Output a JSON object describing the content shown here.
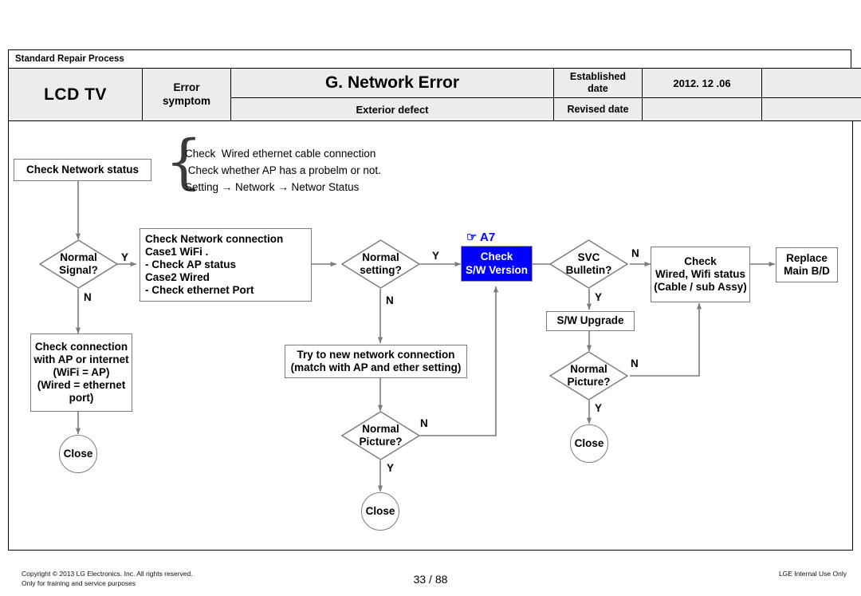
{
  "header": {
    "process_title": "Standard Repair Process",
    "model": "LCD  TV",
    "error_symptom_label": "Error\nsymptom",
    "main_title": "G. Network Error",
    "main_subtitle": "Exterior defect",
    "established_date_label": "Established\ndate",
    "established_date_value": "2012. 12 .06",
    "revised_date_label": "Revised date",
    "revised_date_value": "",
    "blank_cell_top": "",
    "blank_cell_bottom": ""
  },
  "flow": {
    "start_box": "Check  Network status",
    "annotation": "Check  Wired ethernet cable connection\n Check whether AP has a probelm or not.\nSetting → Network → Networ Status",
    "brace_glyph": "{",
    "d_normal_signal": "Normal\nSignal?",
    "check_network_connection": "Check Network connection\nCase1 WiFi .\n- Check AP status\nCase2 Wired\n - Check ethernet Port",
    "check_connection_ap": "Check connection\nwith AP or internet\n(WiFi = AP)\n(Wired = ethernet\nport)",
    "close_left": "Close",
    "d_normal_setting": "Normal\nsetting?",
    "a7_marker": "☞ A7",
    "check_sw_version": "Check\nS/W Version",
    "try_new_network": "Try to new network connection\n(match with AP and ether setting)",
    "d_normal_picture_center": "Normal\nPicture?",
    "close_center": "Close",
    "d_svc_bulletin": "SVC\nBulletin?",
    "sw_upgrade": "S/W Upgrade",
    "d_normal_picture_right": "Normal\nPicture?",
    "close_right": "Close",
    "check_wired_wifi": "Check\nWired, Wifi status\n(Cable / sub Assy)",
    "replace_main_bd": "Replace\nMain B/D",
    "labels": {
      "y_signal": "Y",
      "n_signal": "N",
      "y_setting": "Y",
      "n_setting": "N",
      "n_picture_center": "N",
      "y_picture_center": "Y",
      "n_bulletin": "N",
      "y_bulletin": "Y",
      "n_picture_right": "N",
      "y_picture_right": "Y"
    }
  },
  "footer": {
    "copyright_line1": "Copyright © 2013 LG Electronics. Inc. All rights reserved.",
    "copyright_line2": "Only for training and service purposes",
    "page_number": "33 / 88",
    "internal_notice": "LGE Internal Use Only"
  },
  "colors": {
    "highlight_blue": "#0000FF",
    "header_fill": "#ECECEC",
    "line_gray": "#7B7B7B"
  }
}
